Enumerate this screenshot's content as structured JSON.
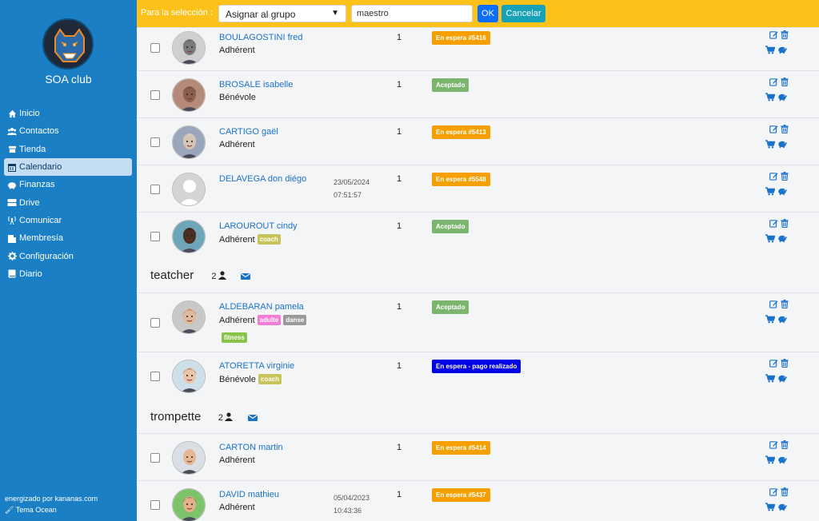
{
  "sidebar": {
    "club_name": "SOA club",
    "items": [
      {
        "label": "Inicio",
        "icon": "home-icon"
      },
      {
        "label": "Contactos",
        "icon": "users-icon"
      },
      {
        "label": "Tienda",
        "icon": "store-icon"
      },
      {
        "label": "Calendario",
        "icon": "calendar-icon",
        "active": true
      },
      {
        "label": "Finanzas",
        "icon": "piggy-bank-icon"
      },
      {
        "label": "Drive",
        "icon": "drive-icon"
      },
      {
        "label": "Comunicar",
        "icon": "broadcast-icon"
      },
      {
        "label": "Membresía",
        "icon": "membership-icon"
      },
      {
        "label": "Configuración",
        "icon": "gear-icon"
      },
      {
        "label": "Diario",
        "icon": "book-icon"
      }
    ],
    "footer_powered": "energizado por kananas.com",
    "footer_theme": "Tema Ocean"
  },
  "toolbar": {
    "selection_label": "Para la selección :",
    "action_select": "Asignar al grupo",
    "group_input": "maestro",
    "ok_label": "OK",
    "cancel_label": "Cancelar"
  },
  "groups": [
    {
      "name": "",
      "members": [
        {
          "name": "BOULAGOSTINI fred",
          "role": "Adhérent",
          "tags": [],
          "date": "",
          "time": "",
          "count": "1",
          "status": "En espera #5416",
          "status_color": "#f59f00"
        },
        {
          "name": "BROSALE isabelle",
          "role": "Bénévole",
          "tags": [],
          "date": "",
          "time": "",
          "count": "1",
          "status": "Aceptado",
          "status_color": "#7cb66e"
        },
        {
          "name": "CARTIGO gaël",
          "role": "Adhérent",
          "tags": [],
          "date": "",
          "time": "",
          "count": "1",
          "status": "En espera #5413",
          "status_color": "#f59f00"
        },
        {
          "name": "DELAVEGA don diégo",
          "role": "",
          "tags": [],
          "date": "23/05/2024",
          "time": "07:51:57",
          "count": "1",
          "status": "En espera #5548",
          "status_color": "#f59f00"
        },
        {
          "name": "LAROUROUT cindy",
          "role": "Adhérent",
          "tags": [
            {
              "label": "coach",
              "color": "#c8c35a"
            }
          ],
          "date": "",
          "time": "",
          "count": "1",
          "status": "Aceptado",
          "status_color": "#7cb66e"
        }
      ]
    },
    {
      "name": "teatcher",
      "count": "2",
      "members": [
        {
          "name": "ALDEBARAN pamela",
          "role": "Adhérent",
          "tags": [
            {
              "label": "adulte",
              "color": "#f37cd6"
            },
            {
              "label": "danse",
              "color": "#9a9a9a"
            },
            {
              "label": "fitness",
              "color": "#8bc34a"
            }
          ],
          "date": "",
          "time": "",
          "count": "1",
          "status": "Aceptado",
          "status_color": "#7cb66e"
        },
        {
          "name": "ATORETTA virginie",
          "role": "Bénévole",
          "tags": [
            {
              "label": "coach",
              "color": "#c8c35a"
            }
          ],
          "date": "",
          "time": "",
          "count": "1",
          "status": "En espera - pago realizado",
          "status_color": "#0000e6"
        }
      ]
    },
    {
      "name": "trompette",
      "count": "2",
      "members": [
        {
          "name": "CARTON martin",
          "role": "Adhérent",
          "tags": [],
          "date": "",
          "time": "",
          "count": "1",
          "status": "En espera #5414",
          "status_color": "#f59f00"
        },
        {
          "name": "DAVID mathieu",
          "role": "Adhérent",
          "tags": [],
          "date": "05/04/2023",
          "time": "10:43:36",
          "count": "1",
          "status": "En espera #5437",
          "status_color": "#f59f00"
        }
      ]
    }
  ],
  "colors": {
    "sidebar": "#1a7fc4",
    "topbar": "#fcc21a",
    "link": "#1a72c9",
    "action": "#1a72c9"
  }
}
